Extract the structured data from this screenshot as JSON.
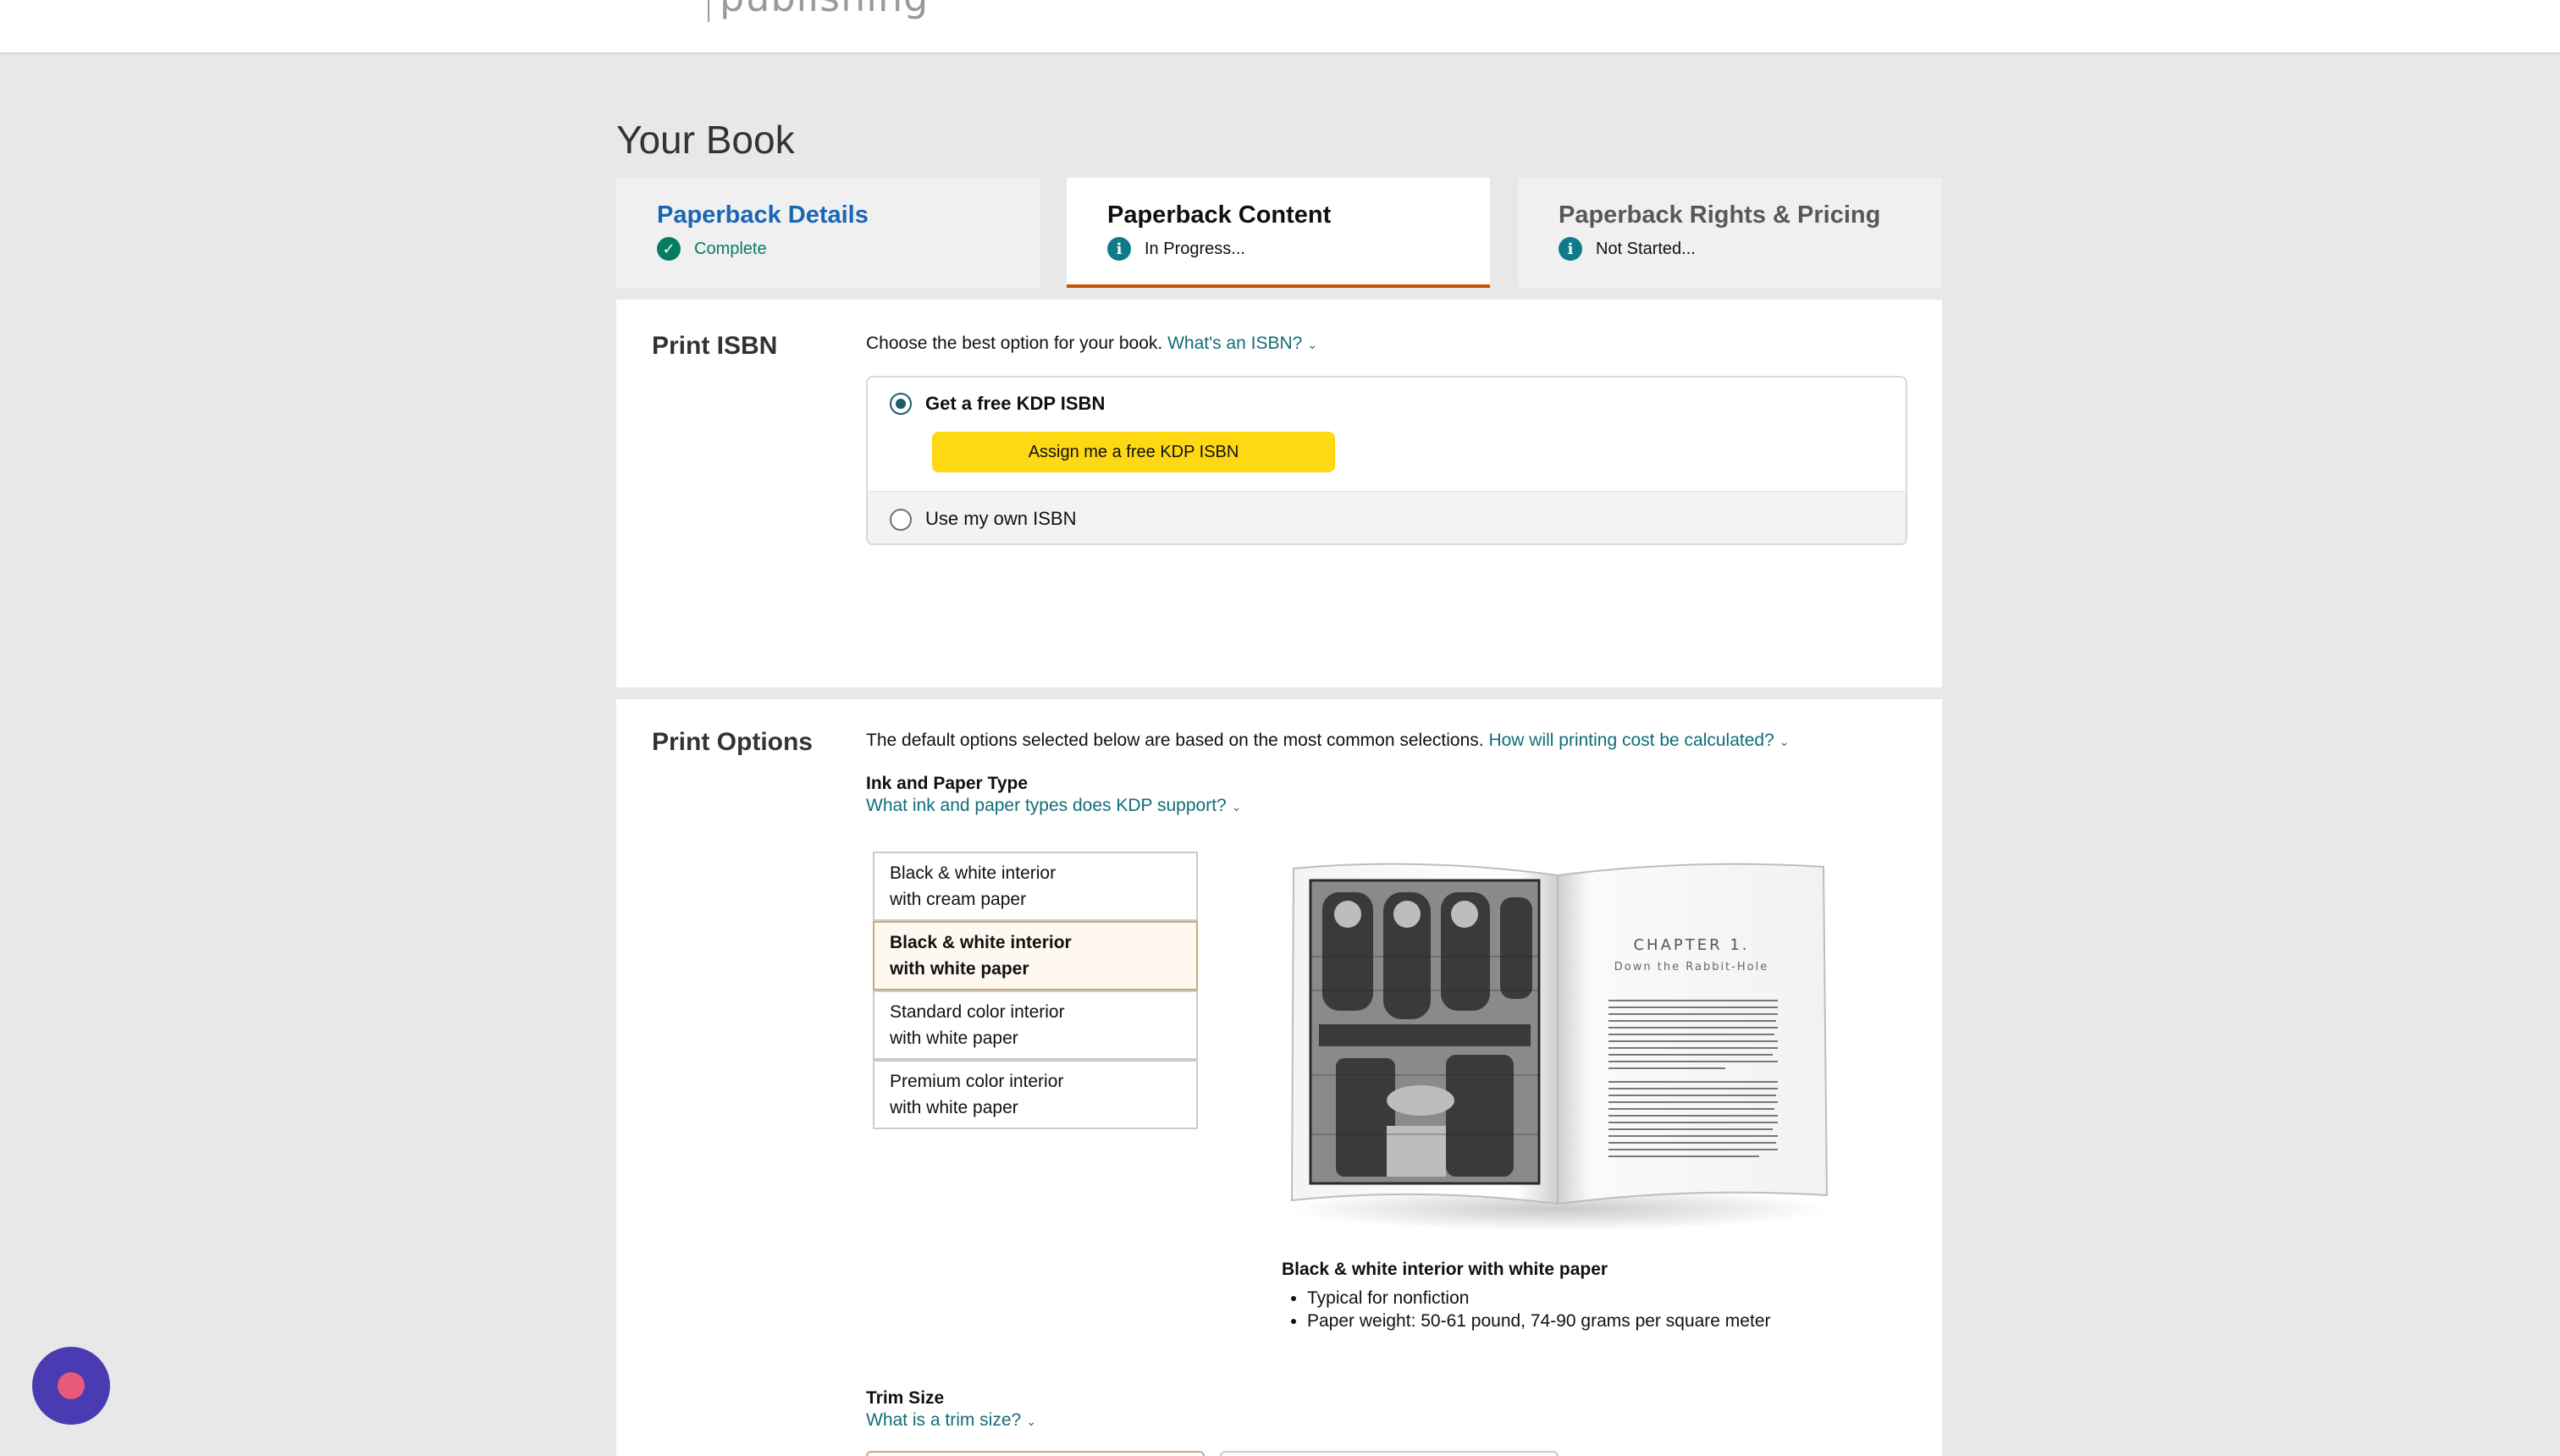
{
  "header": {
    "logo_text": "publishing"
  },
  "page": {
    "title": "Your Book"
  },
  "tabs": [
    {
      "label": "Paperback Details",
      "status": "Complete",
      "color": "#1a66b3"
    },
    {
      "label": "Paperback Content",
      "status": "In Progress...",
      "color": "#0f1111"
    },
    {
      "label": "Paperback Rights & Pricing",
      "status": "Not Started...",
      "color": "#565959"
    }
  ],
  "print_isbn": {
    "label": "Print ISBN",
    "prompt": "Choose the best option for your book.",
    "help_link": "What's an ISBN?",
    "options": [
      {
        "label": "Get a free KDP ISBN",
        "selected": true
      },
      {
        "label": "Use my own ISBN",
        "selected": false
      }
    ],
    "assign_button": "Assign me a free KDP ISBN"
  },
  "print_options": {
    "label": "Print Options",
    "intro": "The default options selected below are based on the most common selections.",
    "cost_link": "How will printing cost be calculated?",
    "ink_heading": "Ink and Paper Type",
    "ink_link": "What ink and paper types does KDP support?",
    "ink_options": [
      {
        "line1": "Black & white interior",
        "line2": "with cream paper",
        "selected": false
      },
      {
        "line1": "Black & white interior",
        "line2": "with white paper",
        "selected": true
      },
      {
        "line1": "Standard color interior",
        "line2": "with white paper",
        "selected": false
      },
      {
        "line1": "Premium color interior",
        "line2": "with white paper",
        "selected": false
      }
    ],
    "preview": {
      "chapter": "CHAPTER 1.",
      "chapter_title": "Down the Rabbit-Hole",
      "caption": "Black & white interior with white paper",
      "bullets": [
        "Typical for nonfiction",
        "Paper weight: 50-61 pound, 74-90 grams per square meter"
      ]
    },
    "trim_heading": "Trim Size",
    "trim_link": "What is a trim size?"
  },
  "colors": {
    "accent_link": "#0f6d7a",
    "tab_active_border": "#c45500",
    "button_yellow": "#ffd814"
  }
}
